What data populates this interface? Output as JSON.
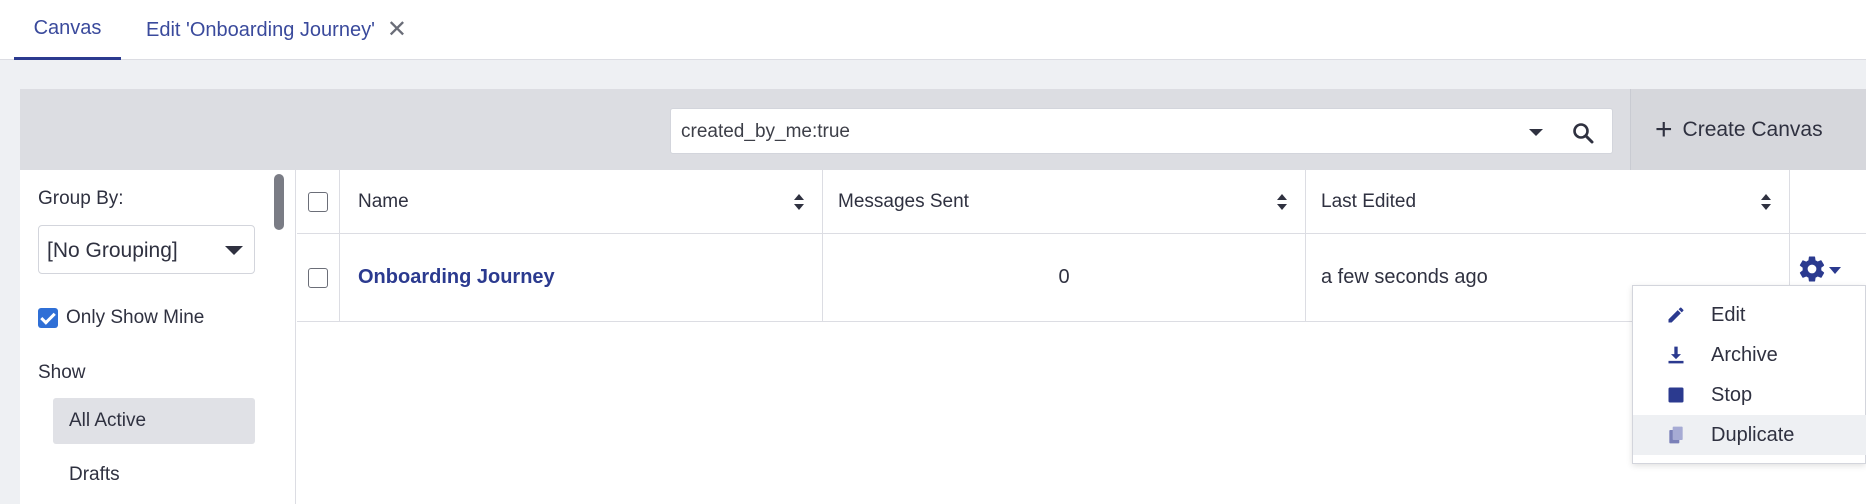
{
  "tabs": [
    {
      "label": "Canvas"
    },
    {
      "label": "Edit 'Onboarding Journey'"
    }
  ],
  "search": {
    "value": "created_by_me:true"
  },
  "toolbar": {
    "create_label": "Create Canvas"
  },
  "sidebar": {
    "group_by_label": "Group By:",
    "group_by_value": "[No Grouping]",
    "only_show_mine_label": "Only Show Mine",
    "only_show_mine_checked": true,
    "show_label": "Show",
    "show_items": [
      {
        "label": "All Active",
        "active": true
      },
      {
        "label": "Drafts",
        "active": false
      }
    ]
  },
  "table": {
    "columns": [
      "Name",
      "Messages Sent",
      "Last Edited"
    ],
    "rows": [
      {
        "name": "Onboarding Journey",
        "messages_sent": "0",
        "last_edited": "a few seconds ago"
      }
    ]
  },
  "menu": {
    "items": [
      {
        "label": "Edit",
        "icon": "pencil-icon"
      },
      {
        "label": "Archive",
        "icon": "download-icon"
      },
      {
        "label": "Stop",
        "icon": "stop-icon"
      },
      {
        "label": "Duplicate",
        "icon": "copy-icon"
      }
    ]
  },
  "colors": {
    "accent": "#2b3a8f",
    "checkbox": "#2f6fd6",
    "toolbar_bg": "#dcdde2",
    "frame_bg": "#eef0f3"
  }
}
